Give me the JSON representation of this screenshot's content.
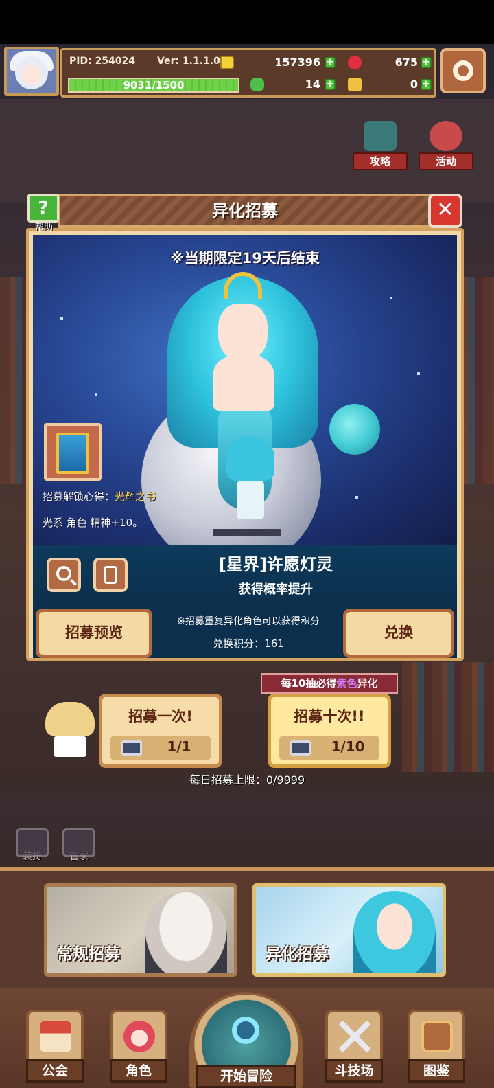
{
  "hud": {
    "pid": "PID: 254024",
    "version": "Ver: 1.1.1.0",
    "gold": "157396",
    "gems": "675",
    "exp_label": "9031/1500",
    "exp_fill_fraction": 1.0,
    "clover": "14",
    "key": "0"
  },
  "side": {
    "strategy": "攻略",
    "events": "活动"
  },
  "dialog": {
    "title": "异化招募",
    "help_label": "帮助",
    "close_symbol": "✕",
    "limited_notice": "※当期限定19天后结束",
    "unlock_prefix": "招募解锁心得：",
    "unlock_book": "光辉之书",
    "unlock_effect": "光系 角色 精神+10。",
    "character_name": "[星界]许愿灯灵",
    "rate_up": "获得概率提升",
    "preview_button": "招募预览",
    "exchange_button": "兑换",
    "duplicate_note": "※招募重复异化角色可以获得积分",
    "points_label": "兑换积分：161"
  },
  "draw": {
    "guarantee_prefix": "每10抽必得",
    "guarantee_color": "紫色",
    "guarantee_suffix": "异化",
    "once_label": "招募一次!",
    "once_cost": "1/1",
    "ten_label": "招募十次!!",
    "ten_cost": "1/10",
    "daily_limit": "每日招募上限：0/9999"
  },
  "mini": {
    "dressup": "装扮",
    "butler": "管家"
  },
  "tabs": {
    "normal": "常规招募",
    "special": "异化招募"
  },
  "nav": {
    "guild": "公会",
    "character": "角色",
    "adventure": "开始冒险",
    "arena": "斗技场",
    "codex": "图鉴"
  },
  "colors": {
    "accent_gold": "#d4a25e",
    "close_red": "#d8372e",
    "help_green": "#47b43a",
    "guarantee_purple": "#d07cff"
  }
}
